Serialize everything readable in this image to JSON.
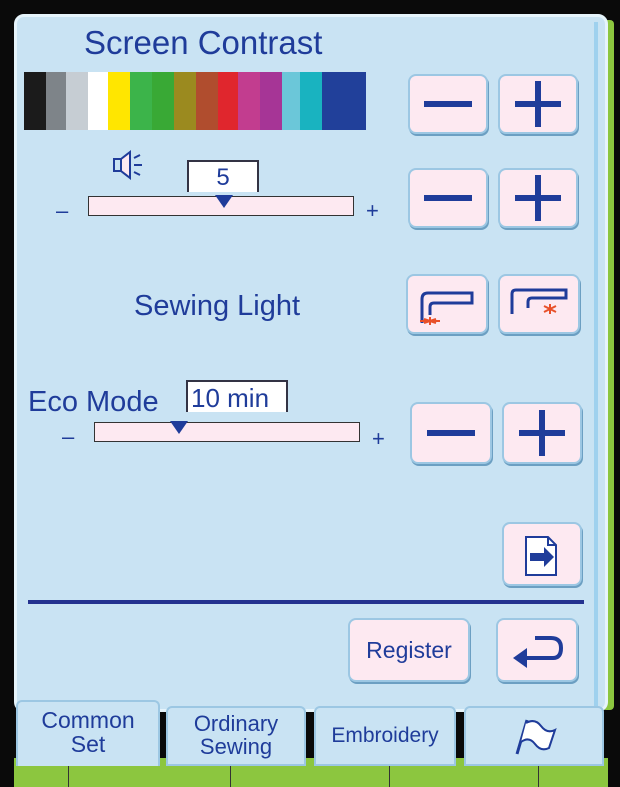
{
  "title": "Screen Contrast",
  "swatch_colors": [
    "#1b1b1b",
    "#7e8489",
    "#c6cdd3",
    "#ffffff",
    "#ffe600",
    "#3cb44a",
    "#39a935",
    "#9b8a1f",
    "#b04d2e",
    "#e0262d",
    "#c23d8f",
    "#a63596",
    "#6bc7d9",
    "#19b3c0",
    "#21409a",
    "#21409a"
  ],
  "volume": {
    "icon": "speaker-icon",
    "value": "5",
    "level": 5
  },
  "sewing_light": {
    "label": "Sewing Light"
  },
  "eco_mode": {
    "label": "Eco Mode",
    "value": "10 min"
  },
  "slider_signs": {
    "minus": "–",
    "plus": "+"
  },
  "buttons": {
    "register": "Register"
  },
  "tabs": [
    {
      "label_line1": "Common",
      "label_line2": "Set"
    },
    {
      "label_line1": "Ordinary",
      "label_line2": "Sewing"
    },
    {
      "label_line1": "Embroidery",
      "label_line2": ""
    }
  ],
  "tab4_icon": "flag-icon",
  "colors": {
    "panel": "#c9e3f3",
    "text": "#1f3c9a",
    "button": "#fde9f1",
    "accent_green": "#8cc63f",
    "divider": "#24328f"
  }
}
